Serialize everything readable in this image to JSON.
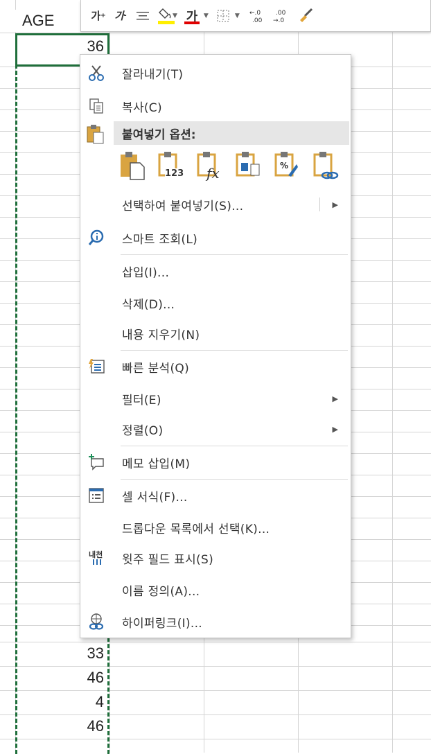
{
  "sheet": {
    "column_header": "AGE",
    "visible_values_top": [
      "36"
    ],
    "visible_values_bottom": [
      "33",
      "46",
      "4",
      "46"
    ]
  },
  "mini_toolbar": {
    "increase_font_label": "가",
    "decrease_font_label": "가",
    "font_color_label": "가",
    "increase_decimal_label": ".0 .00",
    "decrease_decimal_label": ".00 .0",
    "highlight_color": "#ffef00",
    "font_color": "#e00000"
  },
  "context_menu": {
    "cut": "잘라내기(T)",
    "copy": "복사(C)",
    "paste_options": "붙여넣기 옵션:",
    "paste_special": "선택하여 붙여넣기(S)...",
    "smart_lookup": "스마트 조회(L)",
    "insert": "삽입(I)...",
    "delete": "삭제(D)...",
    "clear_contents": "내용 지우기(N)",
    "quick_analysis": "빠른 분석(Q)",
    "filter": "필터(E)",
    "sort": "정렬(O)",
    "insert_comment": "메모 삽입(M)",
    "format_cells": "셀 서식(F)...",
    "pick_from_dropdown": "드롭다운 목록에서 선택(K)...",
    "show_phonetic": "윗주 필드 표시(S)",
    "define_name": "이름 정의(A)...",
    "hyperlink": "하이퍼링크(I)...",
    "submenu_arrow": "▶",
    "paste_123": "123"
  },
  "colors": {
    "copy_border": "#1f6f3b",
    "clipboard": "#d9a441",
    "icon_blue": "#2b6cb0",
    "menu_text": "#333333"
  }
}
